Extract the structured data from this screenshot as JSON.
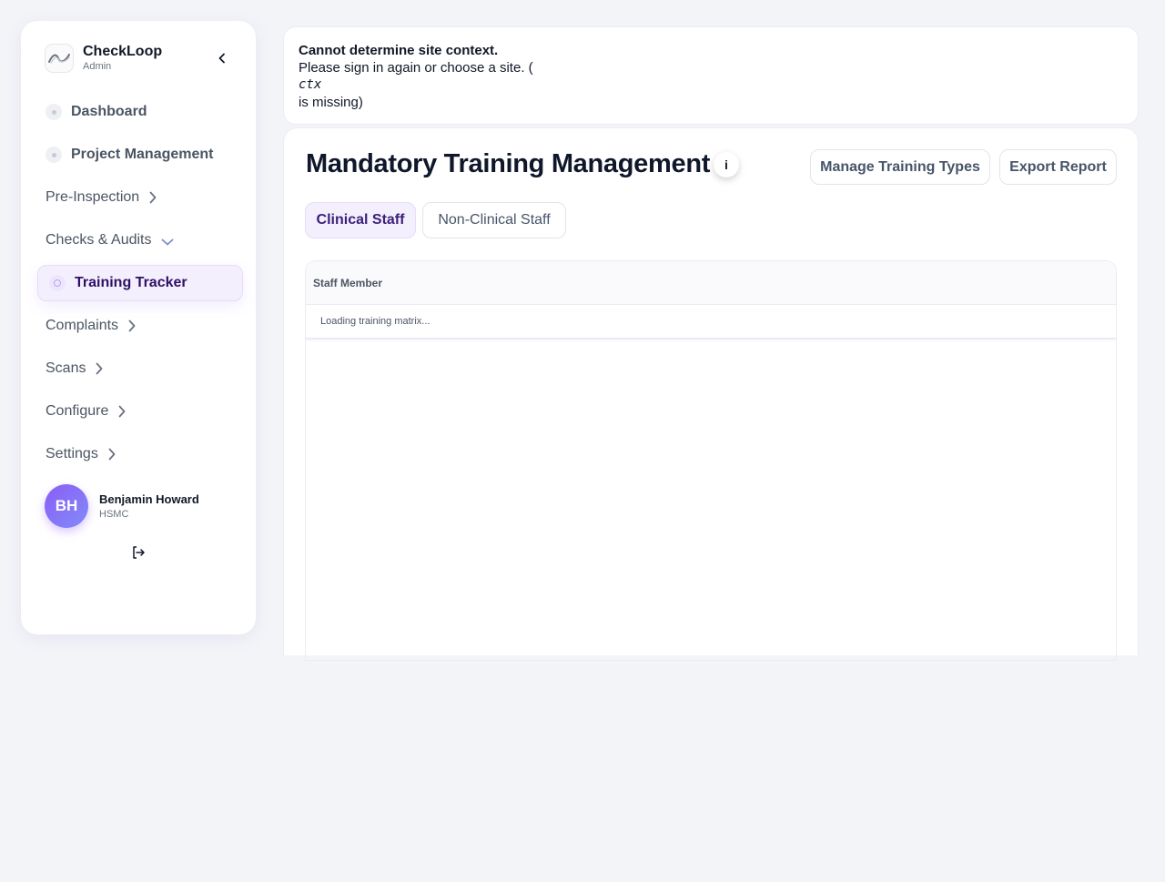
{
  "brand": {
    "name": "CheckLoop",
    "role": "Admin"
  },
  "nav": {
    "dashboard": "Dashboard",
    "project_management": "Project Management",
    "pre_inspection": "Pre-Inspection",
    "checks_audits": "Checks & Audits",
    "training_tracker": "Training Tracker",
    "complaints": "Complaints",
    "scans": "Scans",
    "configure": "Configure",
    "settings": "Settings",
    "active_item": "Training Tracker"
  },
  "user": {
    "initials": "BH",
    "name": "Benjamin Howard",
    "org": "HSMC"
  },
  "banner": {
    "title": "Cannot determine site context.",
    "line1": "Please sign in again or choose a site. (",
    "code": "ctx",
    "line2": "is missing)"
  },
  "page": {
    "title": "Mandatory Training Management",
    "info_label": "i",
    "manage_button": "Manage Training Types",
    "export_button": "Export Report"
  },
  "tabs": {
    "clinical": "Clinical Staff",
    "non_clinical": "Non-Clinical Staff",
    "selected": "Clinical Staff"
  },
  "table": {
    "columns": [
      "Staff Member"
    ],
    "loading_text": "Loading training matrix..."
  },
  "colors": {
    "accent": "#8b5cf6",
    "active_bg": "#f4effd",
    "page_bg": "#f3f4f8"
  },
  "icons": [
    "logo-icon",
    "chevron-left-icon",
    "chevron-right-icon",
    "chevron-down-icon",
    "logout-icon",
    "info-icon"
  ]
}
